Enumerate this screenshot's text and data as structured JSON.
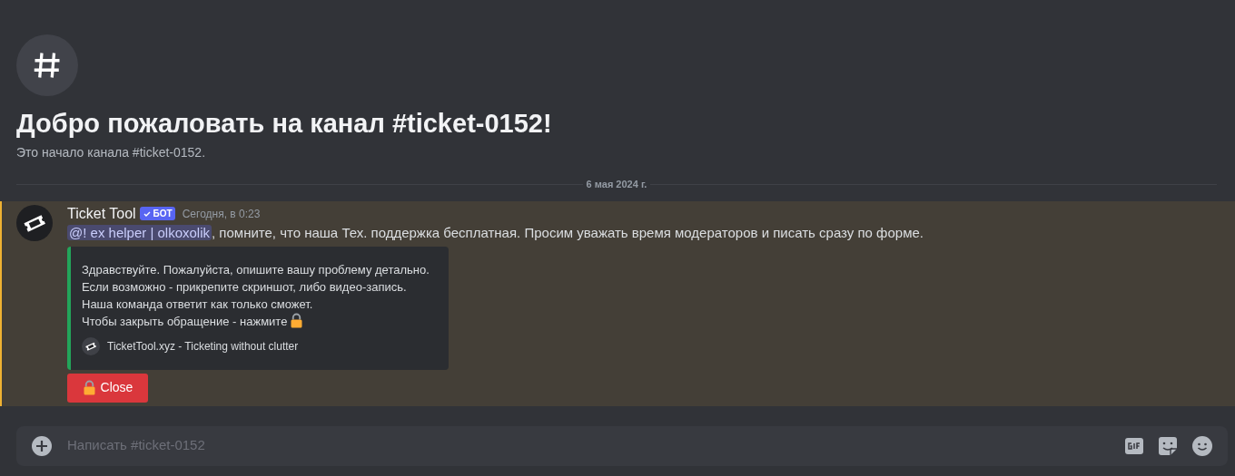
{
  "welcome": {
    "title": "Добро пожаловать на канал #ticket-0152!",
    "subtitle": "Это начало канала #ticket-0152."
  },
  "date_divider": "6 мая 2024 г.",
  "message": {
    "author": "Ticket Tool",
    "badge": "БОТ",
    "time": "Сегодня, в 0:23",
    "highlighted": true,
    "mention": "@! ex helper | olkoxolik",
    "text": ", помните, что наша Тех. поддержка бесплатная. Просим уважать время модераторов и писать сразу по форме.",
    "embed": {
      "color": "#23a55a",
      "lines": [
        "Здравствуйте. Пожалуйста, опишите вашу проблему детально.",
        "Если возможно - прикрепите скриншот, либо видео-запись.",
        "Наша команда ответит как только сможет.",
        "Чтобы закрыть обращение - нажмите"
      ],
      "footer": "TicketTool.xyz - Ticketing without clutter"
    },
    "button": "Close"
  },
  "composer": {
    "placeholder": "Написать #ticket-0152"
  }
}
